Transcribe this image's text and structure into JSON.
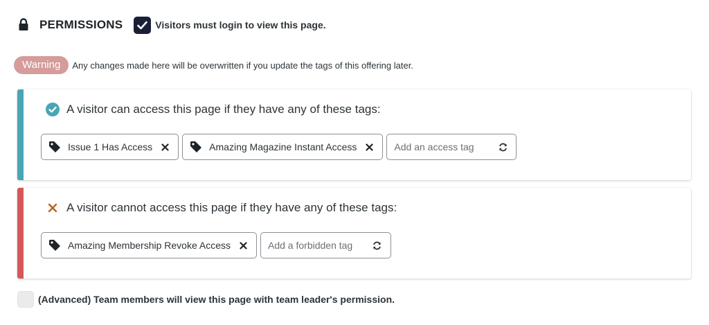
{
  "permissions": {
    "title": "PERMISSIONS",
    "login_checkbox": {
      "checked": true,
      "label": "Visitors must login to view this page."
    }
  },
  "warning": {
    "badge": "Warning",
    "text": "Any changes made here will be overwritten if you update the tags of this offering later."
  },
  "access": {
    "heading": "A visitor can access this page if they have any of these tags:",
    "tags": [
      {
        "label": "Issue 1 Has Access"
      },
      {
        "label": "Amazing Magazine Instant Access"
      }
    ],
    "input_placeholder": "Add an access tag"
  },
  "forbidden": {
    "heading": "A visitor cannot access this page if they have any of these tags:",
    "tags": [
      {
        "label": "Amazing Membership Revoke Access"
      }
    ],
    "input_placeholder": "Add a forbidden tag"
  },
  "advanced": {
    "checked": false,
    "label": "(Advanced) Team members will view this page with team leader's permission."
  },
  "colors": {
    "access_accent": "#4aa6b5",
    "forbid_accent": "#d6575a",
    "warning_badge": "#d69b9b",
    "checkbox_checked": "#1a1f36",
    "forbid_x_icon": "#b5651d"
  },
  "icons": {
    "header": "lock-icon",
    "access_heading": "check-circle-icon",
    "forbid_heading": "x-icon",
    "tag": "tag-icon",
    "remove": "close-icon",
    "input_action": "refresh-icon"
  }
}
